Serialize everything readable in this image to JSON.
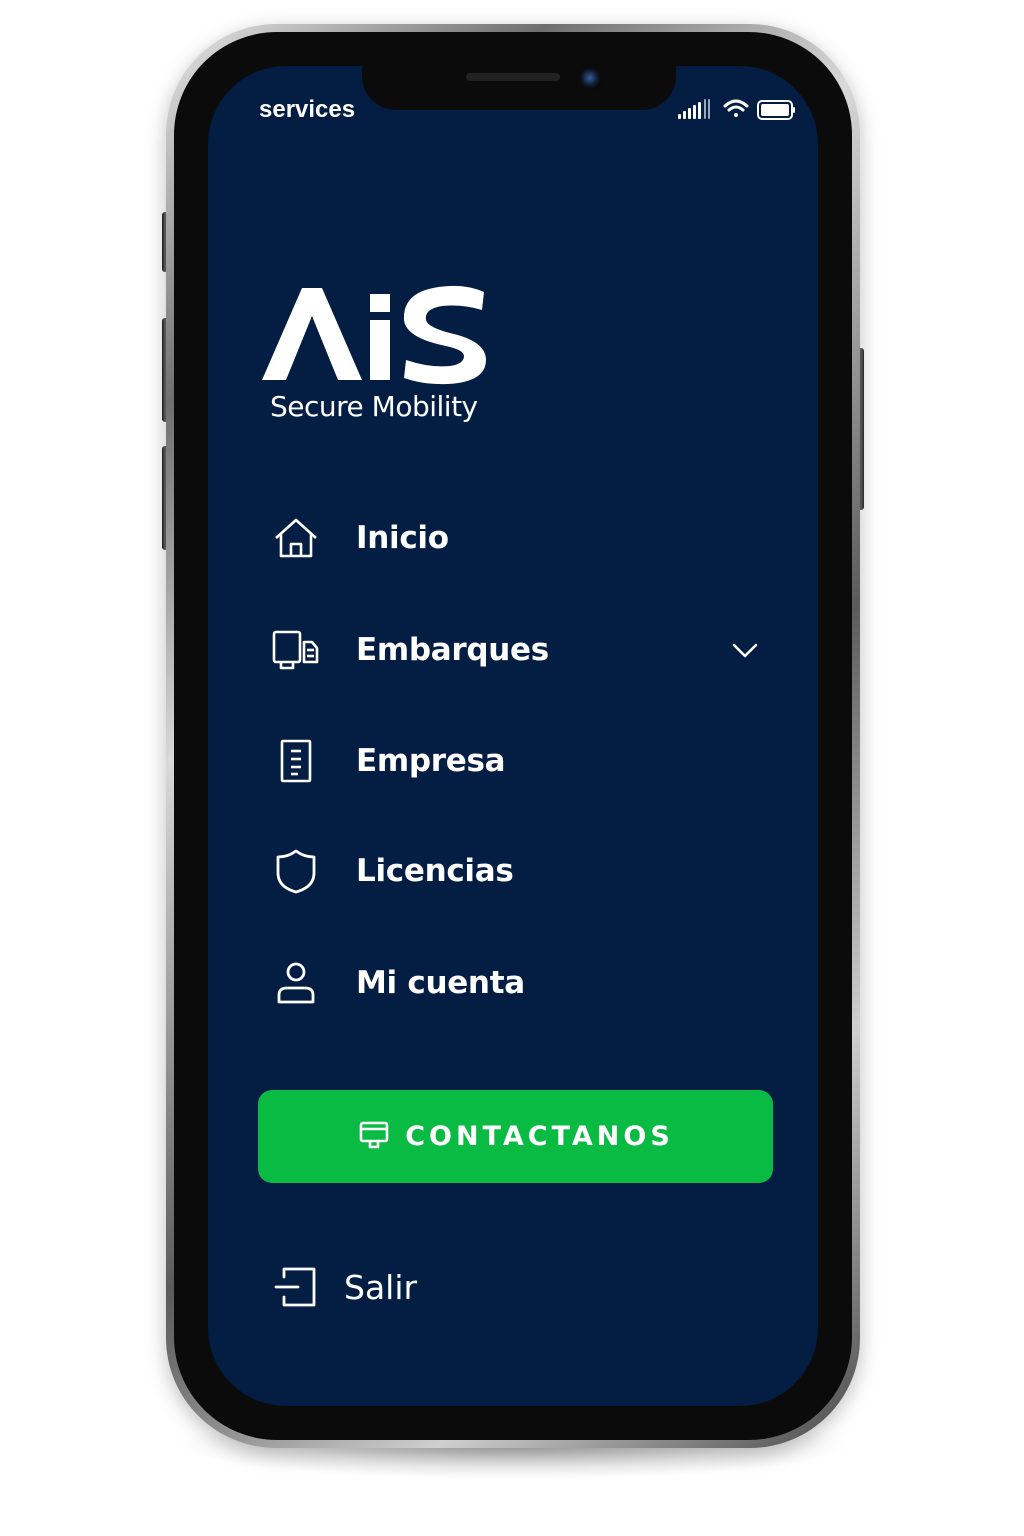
{
  "status_bar": {
    "carrier": "services",
    "icons": [
      "signal-icon",
      "wifi-icon",
      "battery-icon"
    ]
  },
  "brand": {
    "logo_text": "AiS",
    "tagline": "Secure Mobility"
  },
  "menu": {
    "items": [
      {
        "label": "Inicio",
        "icon": "home-icon"
      },
      {
        "label": "Embarques",
        "icon": "shipment-icon",
        "expandable": true
      },
      {
        "label": "Empresa",
        "icon": "building-icon"
      },
      {
        "label": "Licencias",
        "icon": "shield-icon"
      },
      {
        "label": "Mi cuenta",
        "icon": "user-icon"
      }
    ]
  },
  "contact_button": {
    "label": "CONTACTANOS",
    "icon": "monitor-icon"
  },
  "logout": {
    "label": "Salir",
    "icon": "logout-icon"
  },
  "colors": {
    "background": "#031d43",
    "accent": "#0abb43",
    "text": "#ffffff"
  }
}
